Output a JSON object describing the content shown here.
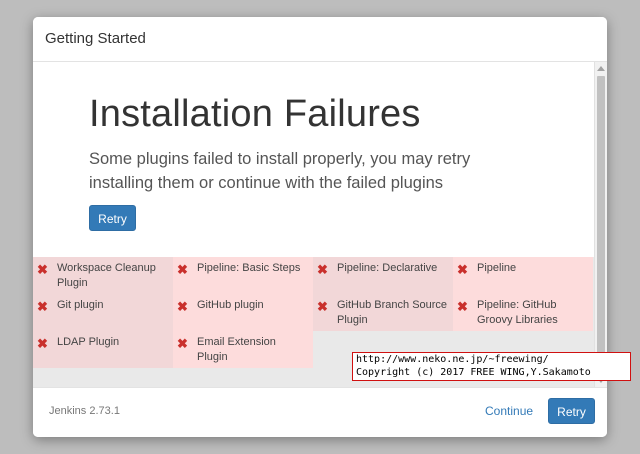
{
  "dialog": {
    "title": "Getting Started"
  },
  "hero": {
    "title": "Installation Failures",
    "text": "Some plugins failed to install properly, you may retry installing them or continue with the failed plugins",
    "retry_label": "Retry"
  },
  "plugins": [
    {
      "name": "Workspace Cleanup Plugin",
      "status_icon": "x-icon",
      "status": "failed"
    },
    {
      "name": "Pipeline: Basic Steps",
      "status_icon": "x-icon",
      "status": "failed"
    },
    {
      "name": "Pipeline: Declarative",
      "status_icon": "x-icon",
      "status": "failed"
    },
    {
      "name": "Pipeline",
      "status_icon": "x-icon",
      "status": "failed"
    },
    {
      "name": "Git plugin",
      "status_icon": "x-icon",
      "status": "failed"
    },
    {
      "name": "GitHub plugin",
      "status_icon": "x-icon",
      "status": "failed"
    },
    {
      "name": "GitHub Branch Source Plugin",
      "status_icon": "x-icon",
      "status": "failed"
    },
    {
      "name": "Pipeline: GitHub Groovy Libraries",
      "status_icon": "x-icon",
      "status": "failed"
    },
    {
      "name": "LDAP Plugin",
      "status_icon": "x-icon",
      "status": "failed"
    },
    {
      "name": "Email Extension Plugin",
      "status_icon": "x-icon",
      "status": "failed"
    }
  ],
  "footer": {
    "version": "Jenkins 2.73.1",
    "continue_label": "Continue",
    "retry_label": "Retry"
  },
  "watermark": {
    "line1": "http://www.neko.ne.jp/~freewing/",
    "line2": "Copyright (c) 2017 FREE WING,Y.Sakamoto"
  },
  "colors": {
    "primary": "#337ab7",
    "failure_icon": "#c9302c",
    "failure_cell_a": "#f2d7d8",
    "failure_cell_b": "#fddcdc"
  }
}
